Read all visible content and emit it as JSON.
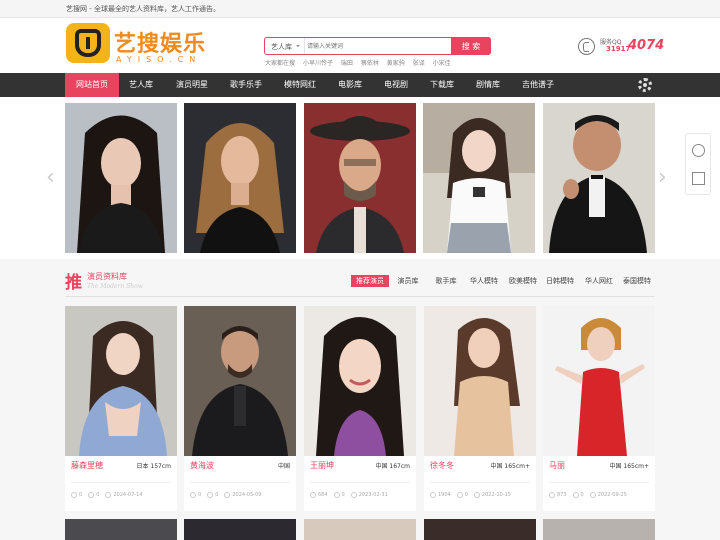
{
  "topbar": {
    "tagline": "艺搜网 - 全球最全的艺人资料库，艺人工作通告。"
  },
  "logo": {
    "text": "艺搜娱乐",
    "sub": "AYISO.CN"
  },
  "search": {
    "category": "艺人库",
    "placeholder": "请输入关键词",
    "button": "搜 索",
    "hot_words": [
      "大家都在搜",
      "小早川怜子",
      "瑞田",
      "蔡依林",
      "黄家驹",
      "张译",
      "小宋佳"
    ]
  },
  "contact": {
    "label": "服务QQ",
    "number": "31917",
    "number_big": "4074"
  },
  "nav": {
    "items": [
      "网站首页",
      "艺人库",
      "演员明星",
      "歌手乐手",
      "模特网红",
      "电影库",
      "电视剧",
      "下载库",
      "剧情库",
      "吉他谱子"
    ],
    "active_index": 0
  },
  "section": {
    "char": "推",
    "title": "演员资料库",
    "subtitle": "The Modern Show",
    "tabs": [
      "推荐演员",
      "演员库",
      "歌手库",
      "华人模特",
      "欧美模特",
      "日韩模特",
      "华人网红",
      "泰国模特"
    ],
    "active_tab": 0
  },
  "cards": [
    {
      "name": "藤森里穂",
      "meta": "日本 157cm",
      "views": "0",
      "comments": "0",
      "date": "2024-07-14"
    },
    {
      "name": "黄海波",
      "meta": "中国",
      "views": "0",
      "comments": "0",
      "date": "2024-05-09"
    },
    {
      "name": "王丽坤",
      "meta": "中国 167cm",
      "views": "684",
      "comments": "0",
      "date": "2023-02-31"
    },
    {
      "name": "徐冬冬",
      "meta": "中国 165cm+",
      "views": "1904",
      "comments": "0",
      "date": "2022-10-15"
    },
    {
      "name": "马丽",
      "meta": "中国 165cm+",
      "views": "873",
      "comments": "0",
      "date": "2022-09-25"
    }
  ],
  "colors": {
    "accent": "#e8435f",
    "nav_bg": "#333333",
    "logo_orange": "#f08a1c",
    "logo_yellow": "#f5b31a"
  }
}
